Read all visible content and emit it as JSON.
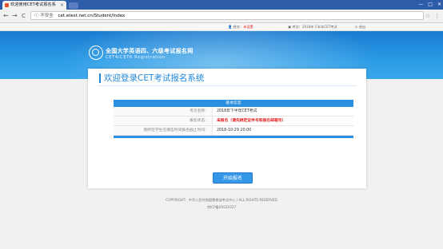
{
  "browser": {
    "tab_title": "欢迎使用CET考试报名系",
    "tab_close": "×",
    "back": "←",
    "forward": "→",
    "reload": "C",
    "security_label": "ⓘ 不安全",
    "url": "cet.etest.net.cn/Student/Index",
    "star": "☆",
    "menu": "⋮",
    "win_min": "—",
    "win_max": "□",
    "win_close": "✕"
  },
  "topnav": {
    "name_label": "姓名：",
    "name_value": "未设置",
    "exam_label": "考次：",
    "exam_value": "2018年下半年CET考试",
    "logout": "退出"
  },
  "header": {
    "title": "全国大学英语四、六级考试报名网",
    "subtitle": "CET4/CET6   Registration"
  },
  "main": {
    "heading": "欢迎登录CET考试报名系统",
    "info_title": "基本信息",
    "rows": [
      {
        "label": "考次名称：",
        "value": "2018年下半年CET考试"
      },
      {
        "label": "报名状态：",
        "value": "未报名（请先绑定证件号和报名邮箱号）"
      },
      {
        "label": "我所在学生在哪些时间报名截止时间：",
        "value": "2018-10-29 20:00"
      }
    ],
    "start_button": "开始报名"
  },
  "footer": {
    "copyright": "COPYRIGHT：中华人民共和国教育部考试中心 / ALL RIGHTS RESERVED",
    "icp": "京ICP备05031027"
  },
  "colors": {
    "brand_blue": "#1f86d8",
    "header_blue": "#2a9be6",
    "alert_red": "#e21b1b"
  },
  "icons": [
    "favicon",
    "back-arrow",
    "forward-arrow",
    "reload",
    "lock-warning",
    "star",
    "menu",
    "user-icon",
    "exam-icon",
    "logout-icon",
    "cet-logo"
  ]
}
